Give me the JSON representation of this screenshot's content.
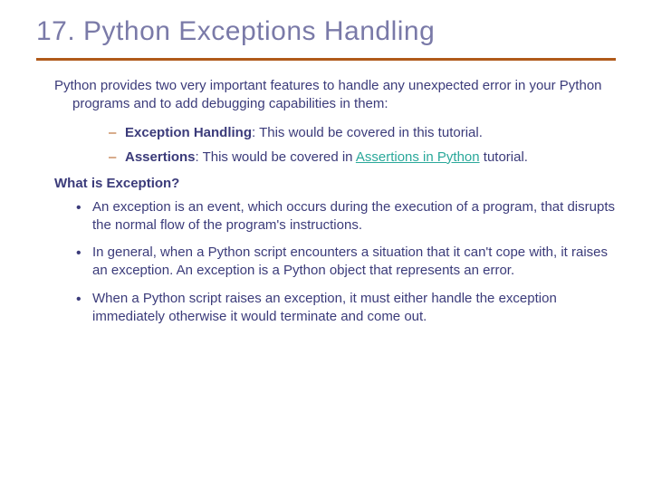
{
  "title": "17. Python Exceptions Handling",
  "intro": "Python provides two very important features to handle any unexpected error in your Python programs and to add debugging capabilities in them:",
  "sublist": [
    {
      "bold": "Exception Handling",
      "rest": ": This would be covered in this tutorial."
    },
    {
      "bold": "Assertions",
      "rest_before": ": This would be covered in ",
      "link_text": "Assertions in Python",
      "rest_after": " tutorial."
    }
  ],
  "heading2": "What is Exception?",
  "bullets": [
    "An exception is an event, which occurs during the execution of a program, that disrupts the normal flow of the program's instructions.",
    "In general, when a Python script encounters a situation that it can't cope with, it raises an exception. An exception is a Python object that represents an error.",
    "When a Python script raises an exception, it must either handle the exception immediately otherwise it would terminate and come out."
  ]
}
